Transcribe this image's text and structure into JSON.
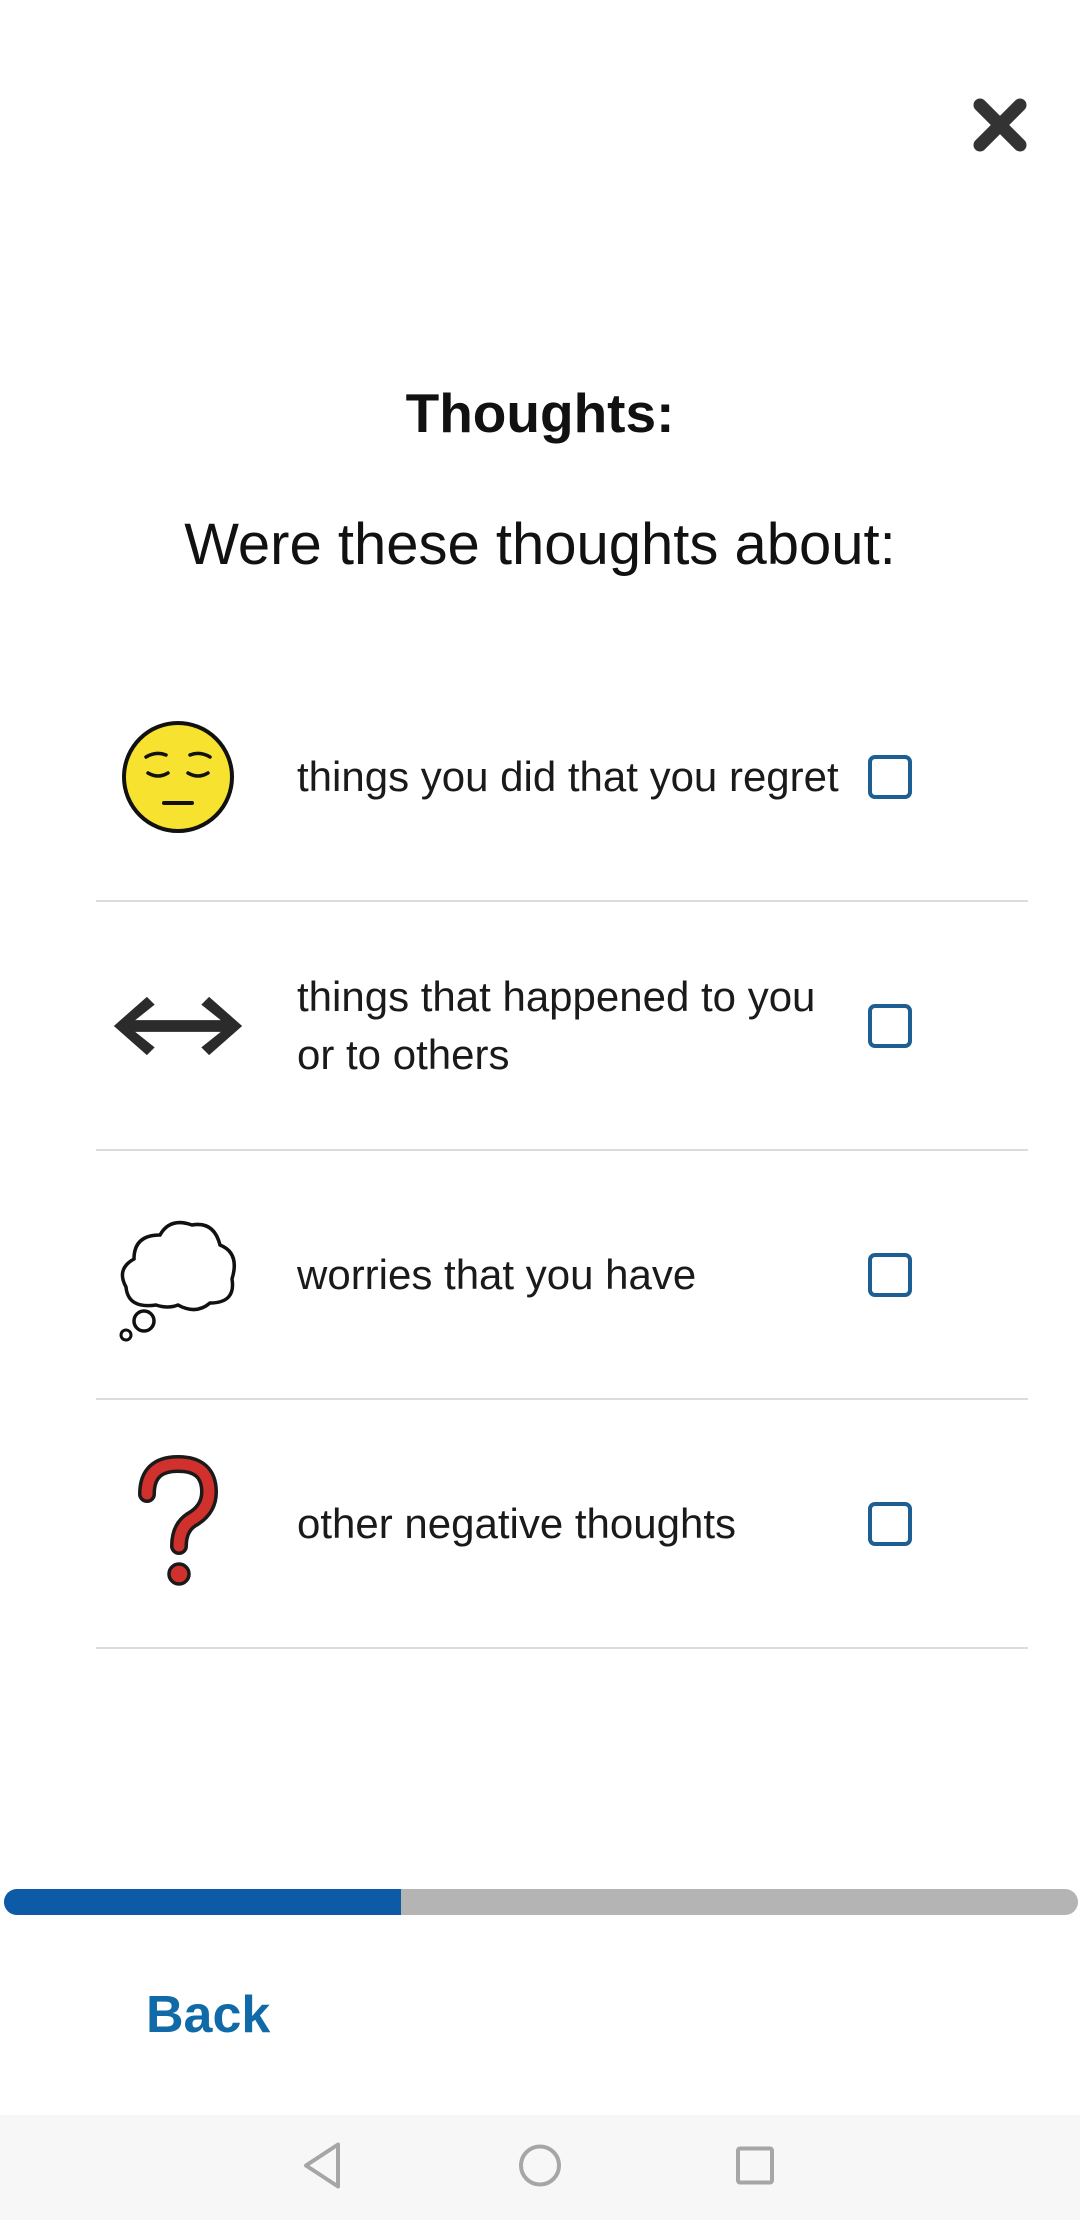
{
  "header": {
    "close_icon": "close-icon"
  },
  "title": "Thoughts:",
  "subtitle": "Were these thoughts about:",
  "options": [
    {
      "label": "things you did that you regret",
      "icon": "pensive-face-icon",
      "checked": false
    },
    {
      "label": "things that happened to you or to others",
      "icon": "left-right-arrow-icon",
      "checked": false
    },
    {
      "label": "worries that you have",
      "icon": "thought-balloon-icon",
      "checked": false
    },
    {
      "label": "other negative thoughts",
      "icon": "question-mark-icon",
      "checked": false
    }
  ],
  "progress": {
    "fraction": 0.37,
    "fill_color": "#0d5aa7",
    "track_color": "#b4b4b4"
  },
  "footer": {
    "back_label": "Back"
  },
  "colors": {
    "accent": "#116aa8",
    "checkbox_border": "#1d5e93"
  },
  "navbar": {
    "icons": [
      "back-triangle-icon",
      "home-circle-icon",
      "recents-square-icon"
    ]
  }
}
